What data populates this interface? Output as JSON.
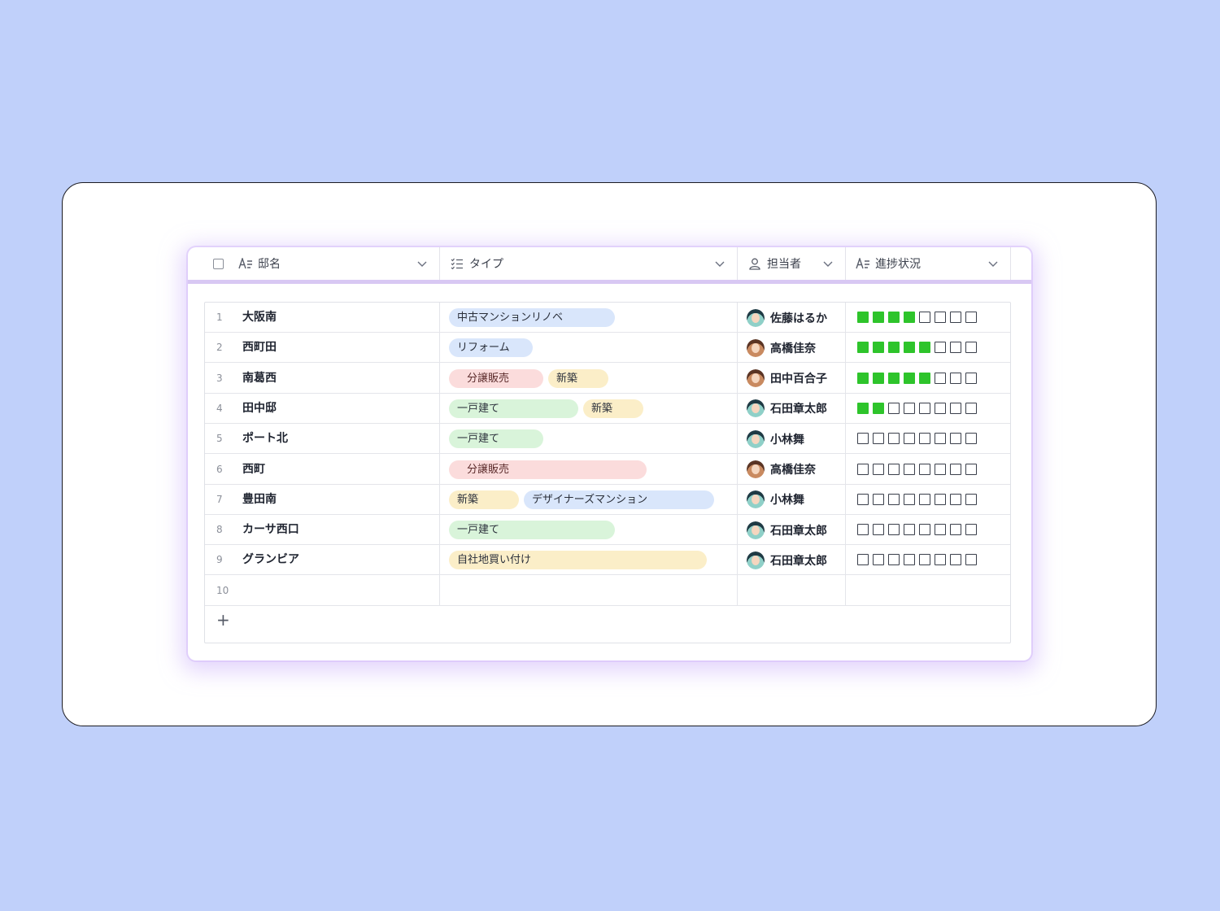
{
  "header": {
    "col_name": "邸名",
    "col_type": "タイプ",
    "col_owner": "担当者",
    "col_progress": "進捗状況"
  },
  "progress_total": 8,
  "colors": {
    "background": "#c0d0fa",
    "progress_on": "#2ec42b",
    "tag_blue": "#d9e6fb",
    "tag_pink": "#fbdcdc",
    "tag_yellow": "#fbeec8",
    "tag_green": "#d9f4da"
  },
  "rows": [
    {
      "num": "1",
      "name": "大阪南",
      "tags": [
        {
          "label": "中古マンションリノベ",
          "color": "blue",
          "width": 204
        }
      ],
      "owner": "佐藤はるか",
      "avatar": "teal",
      "progress": 4
    },
    {
      "num": "2",
      "name": "西町田",
      "tags": [
        {
          "label": "リフォーム",
          "color": "blue",
          "width": 103
        }
      ],
      "owner": "高橋佳奈",
      "avatar": "brown",
      "progress": 5
    },
    {
      "num": "3",
      "name": "南葛西",
      "tags": [
        {
          "label": "分譲販売",
          "color": "pink",
          "width": 116
        },
        {
          "label": "新築",
          "color": "yellow",
          "width": 74
        }
      ],
      "owner": "田中百合子",
      "avatar": "brown",
      "progress": 5
    },
    {
      "num": "4",
      "name": "田中邸",
      "tags": [
        {
          "label": "一戸建て",
          "color": "green",
          "width": 159
        },
        {
          "label": "新築",
          "color": "yellow",
          "width": 74
        }
      ],
      "owner": "石田章太郎",
      "avatar": "teal",
      "progress": 2
    },
    {
      "num": "5",
      "name": "ポート北",
      "tags": [
        {
          "label": "一戸建て",
          "color": "green",
          "width": 116
        }
      ],
      "owner": "小林舞",
      "avatar": "teal",
      "progress": 0
    },
    {
      "num": "6",
      "name": "西町",
      "tags": [
        {
          "label": "分譲販売",
          "color": "pink",
          "width": 243
        }
      ],
      "owner": "高橋佳奈",
      "avatar": "brown",
      "progress": 0
    },
    {
      "num": "7",
      "name": "豊田南",
      "tags": [
        {
          "label": "新築",
          "color": "yellow",
          "width": 86
        },
        {
          "label": "デザイナーズマンション",
          "color": "blue",
          "width": 234
        }
      ],
      "owner": "小林舞",
      "avatar": "teal",
      "progress": 0
    },
    {
      "num": "8",
      "name": "カーサ西口",
      "tags": [
        {
          "label": "一戸建て",
          "color": "green",
          "width": 204
        }
      ],
      "owner": "石田章太郎",
      "avatar": "teal",
      "progress": 0
    },
    {
      "num": "9",
      "name": "グランビア",
      "tags": [
        {
          "label": "自社地買い付け",
          "color": "yellow",
          "width": 317
        }
      ],
      "owner": "石田章太郎",
      "avatar": "teal",
      "progress": 0
    },
    {
      "num": "10",
      "name": "",
      "tags": [],
      "owner": "",
      "avatar": "",
      "progress": null
    }
  ],
  "add_row_label": "+"
}
